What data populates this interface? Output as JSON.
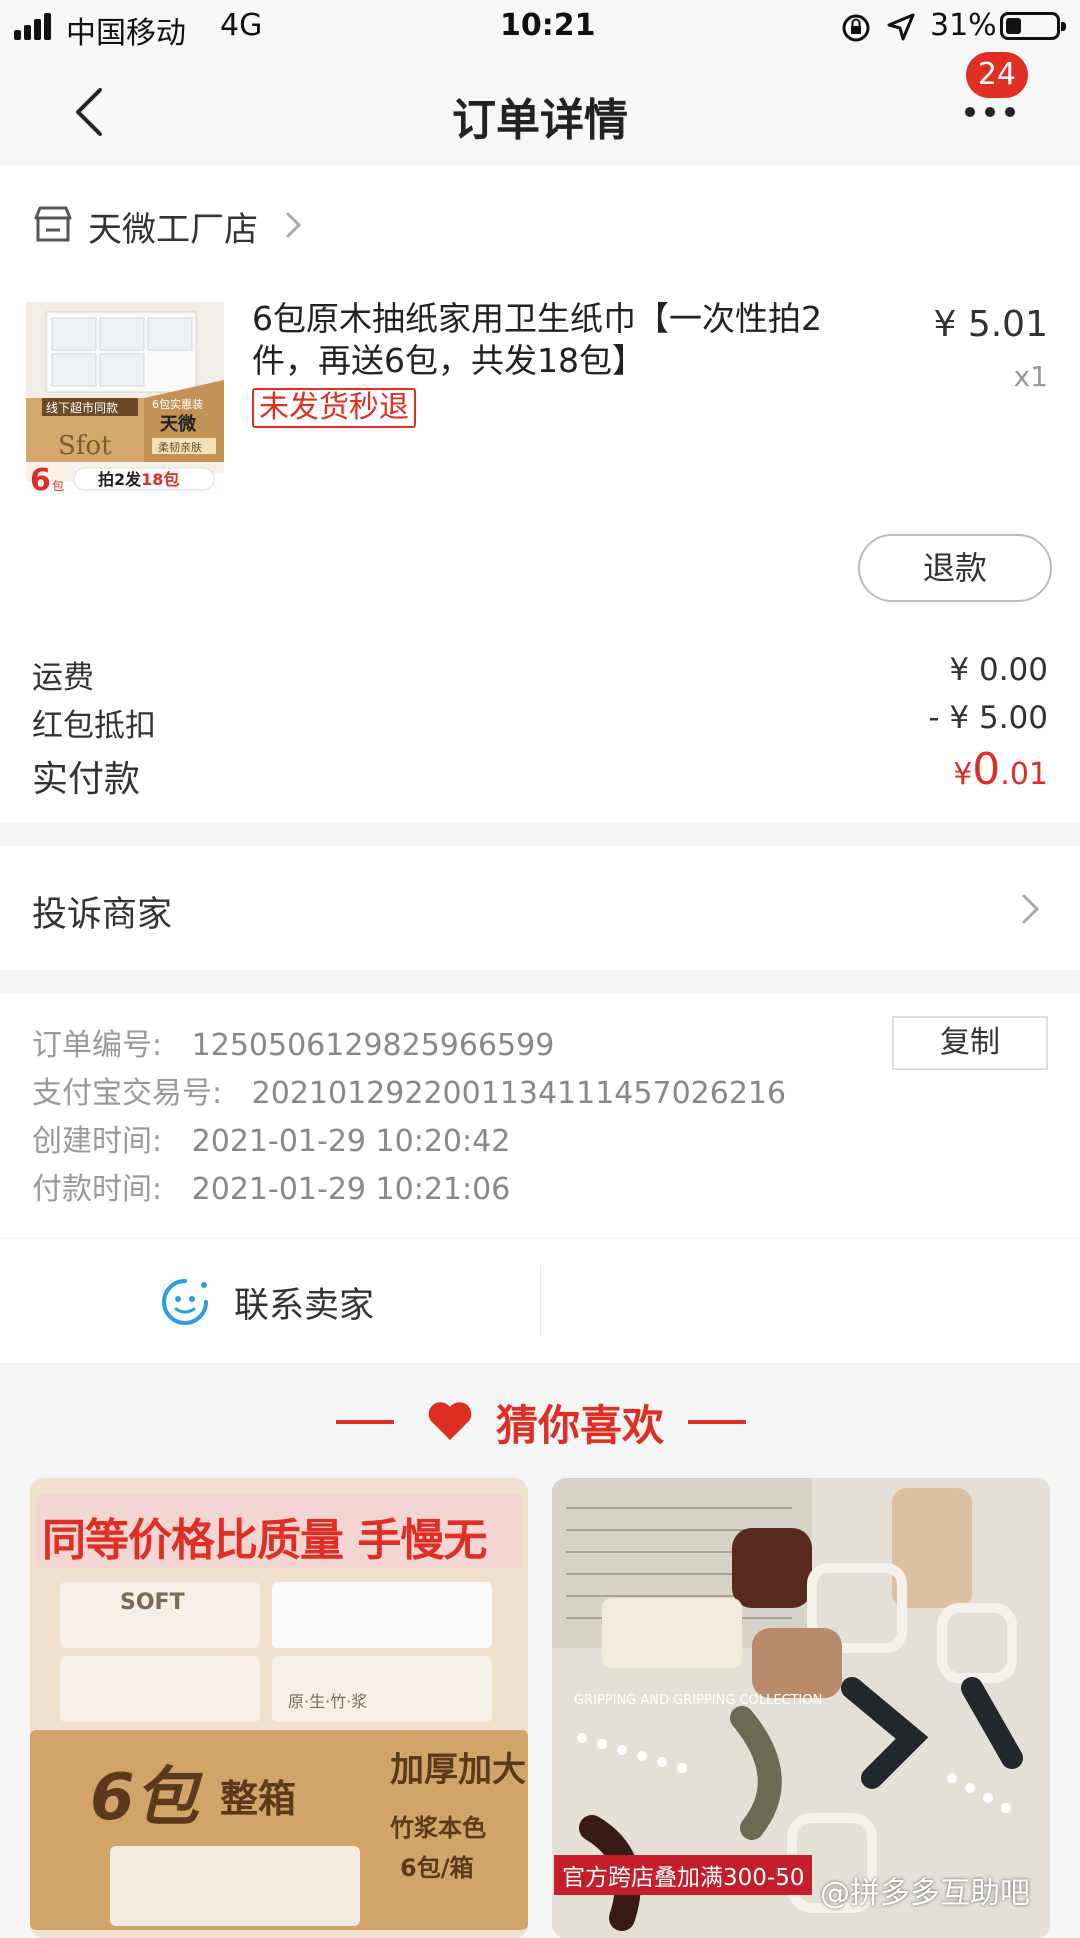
{
  "status_bar": {
    "carrier": "中国移动",
    "network": "4G",
    "time": "10:21",
    "battery": "31%",
    "battery_level": 0.31
  },
  "header": {
    "title": "订单详情",
    "more_badge": "24",
    "back_icon": "chevron-left-icon",
    "more_icon": "more-dots-icon"
  },
  "store": {
    "name": "天微工厂店"
  },
  "product": {
    "title": "6包原木抽纸家用卫生纸巾【一次性拍2件，再送6包，共发18包】",
    "tag": "未发货秒退",
    "price": "¥ 5.01",
    "quantity": "x1",
    "refund_label": "退款",
    "image": {
      "brand_cn": "天微",
      "brand_en": "Sfot",
      "offline": "线下超市同款",
      "slogan": "柔韧亲肤",
      "pack_badge": "6包实惠装",
      "count": "6",
      "unit": "包",
      "promo_prefix": "拍2发",
      "promo_highlight": "18包"
    }
  },
  "fees": {
    "shipping_label": "运费",
    "shipping_value": "¥ 0.00",
    "coupon_label": "红包抵扣",
    "coupon_value": "- ¥ 5.00",
    "paid_label": "实付款",
    "paid_currency": "¥",
    "paid_int": "0",
    "paid_dec": ".01"
  },
  "complaint": {
    "label": "投诉商家"
  },
  "order_info": {
    "order_no_label": "订单编号:",
    "order_no": "1250506129825966599",
    "copy_label": "复制",
    "alipay_label": "支付宝交易号:",
    "alipay_no": "2021012922001134111457026216",
    "created_label": "创建时间:",
    "created": "2021-01-29 10:20:42",
    "paid_label": "付款时间:",
    "paid": "2021-01-29 10:21:06"
  },
  "contact": {
    "label": "联系卖家"
  },
  "recommend": {
    "title": "猜你喜欢",
    "card1": {
      "banner": "同等价格比质量 手慢无",
      "brand": "SOFT",
      "sub": "原·生·竹·浆",
      "big": "6包",
      "big2": "整箱",
      "side": "加厚加大",
      "tag1": "竹浆本色",
      "tag2": "6包/箱"
    },
    "card2": {
      "caption": "GRIPPING AND GRIPPING COLLECTION",
      "promo": "官方跨店叠加满300-50"
    }
  },
  "watermark": "@拼多多互助吧",
  "colors": {
    "accent": "#e02e24",
    "background": "#f5f5f5"
  }
}
